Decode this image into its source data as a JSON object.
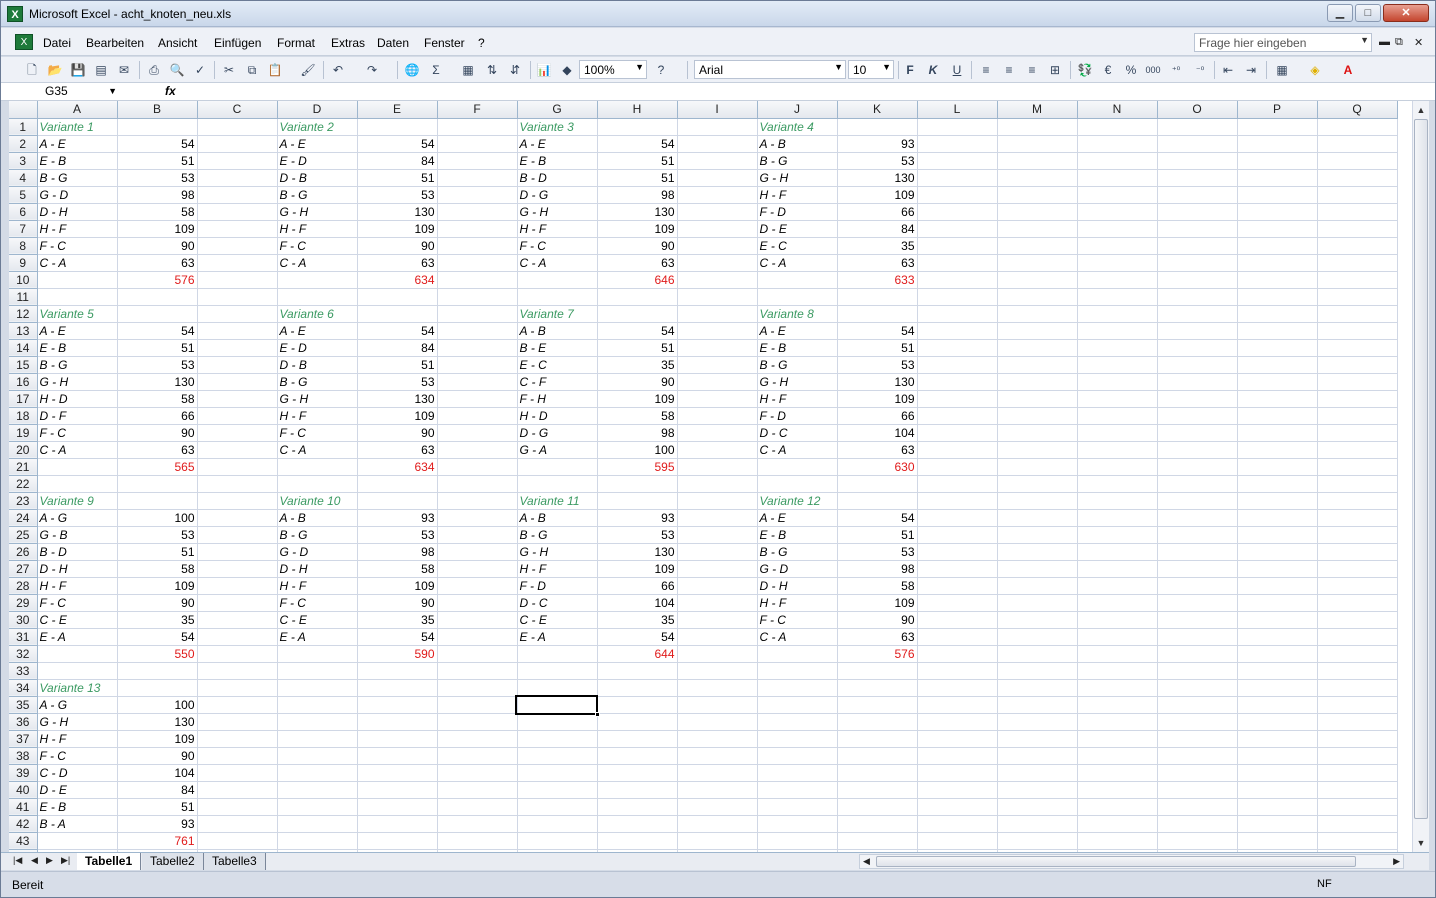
{
  "window": {
    "title": "Microsoft Excel - acht_knoten_neu.xls",
    "app_icon": "X",
    "minimize": "▁",
    "maximize": "□",
    "close": "✕"
  },
  "menu": {
    "items": [
      "Datei",
      "Bearbeiten",
      "Ansicht",
      "Einfügen",
      "Format",
      "Extras",
      "Daten",
      "Fenster",
      "?"
    ],
    "help_placeholder": "Frage hier eingeben",
    "doc_minimize": "▬",
    "doc_restore": "⧉",
    "doc_close": "✕"
  },
  "toolbar": {
    "zoom": "100%",
    "font_name": "Arial",
    "font_size": "10",
    "bold": "F",
    "italic": "K",
    "underline": "U",
    "currency": "€",
    "percent": "%",
    "thousands": "000"
  },
  "formula_bar": {
    "name_box": "G35",
    "fx": "fx",
    "content": ""
  },
  "sheet": {
    "columns": [
      "A",
      "B",
      "C",
      "D",
      "E",
      "F",
      "G",
      "H",
      "I",
      "J",
      "K",
      "L",
      "M",
      "N",
      "O",
      "P",
      "Q"
    ],
    "selected_column": "G",
    "selected_row": 35,
    "selected_cell": "G35",
    "blocks": [
      {
        "title": "Variante 1",
        "rows": [
          [
            "A - E",
            "54"
          ],
          [
            "E - B",
            "51"
          ],
          [
            "B - G",
            "53"
          ],
          [
            "G - D",
            "98"
          ],
          [
            "D - H",
            "58"
          ],
          [
            "H - F",
            "109"
          ],
          [
            "F - C",
            "90"
          ],
          [
            "C - A",
            "63"
          ]
        ],
        "sum": "576"
      },
      {
        "title": "Variante 2",
        "rows": [
          [
            "A - E",
            "54"
          ],
          [
            "E - D",
            "84"
          ],
          [
            "D - B",
            "51"
          ],
          [
            "B - G",
            "53"
          ],
          [
            "G - H",
            "130"
          ],
          [
            "H - F",
            "109"
          ],
          [
            "F - C",
            "90"
          ],
          [
            "C - A",
            "63"
          ]
        ],
        "sum": "634"
      },
      {
        "title": "Variante 3",
        "rows": [
          [
            "A - E",
            "54"
          ],
          [
            "E - B",
            "51"
          ],
          [
            "B - D",
            "51"
          ],
          [
            "D - G",
            "98"
          ],
          [
            "G - H",
            "130"
          ],
          [
            "H - F",
            "109"
          ],
          [
            "F - C",
            "90"
          ],
          [
            "C - A",
            "63"
          ]
        ],
        "sum": "646"
      },
      {
        "title": "Variante 4",
        "rows": [
          [
            "A - B",
            "93"
          ],
          [
            "B - G",
            "53"
          ],
          [
            "G - H",
            "130"
          ],
          [
            "H - F",
            "109"
          ],
          [
            "F - D",
            "66"
          ],
          [
            "D - E",
            "84"
          ],
          [
            "E - C",
            "35"
          ],
          [
            "C - A",
            "63"
          ]
        ],
        "sum": "633"
      },
      {
        "title": "Variante 5",
        "rows": [
          [
            "A - E",
            "54"
          ],
          [
            "E - B",
            "51"
          ],
          [
            "B - G",
            "53"
          ],
          [
            "G - H",
            "130"
          ],
          [
            "H - D",
            "58"
          ],
          [
            "D - F",
            "66"
          ],
          [
            "F - C",
            "90"
          ],
          [
            "C - A",
            "63"
          ]
        ],
        "sum": "565"
      },
      {
        "title": "Variante 6",
        "rows": [
          [
            "A - E",
            "54"
          ],
          [
            "E - D",
            "84"
          ],
          [
            "D - B",
            "51"
          ],
          [
            "B - G",
            "53"
          ],
          [
            "G - H",
            "130"
          ],
          [
            "H - F",
            "109"
          ],
          [
            "F - C",
            "90"
          ],
          [
            "C - A",
            "63"
          ]
        ],
        "sum": "634"
      },
      {
        "title": "Variante 7",
        "rows": [
          [
            "A - B",
            "54"
          ],
          [
            "B - E",
            "51"
          ],
          [
            "E - C",
            "35"
          ],
          [
            "C - F",
            "90"
          ],
          [
            "F - H",
            "109"
          ],
          [
            "H - D",
            "58"
          ],
          [
            "D - G",
            "98"
          ],
          [
            "G - A",
            "100"
          ]
        ],
        "sum": "595"
      },
      {
        "title": "Variante 8",
        "rows": [
          [
            "A - E",
            "54"
          ],
          [
            "E - B",
            "51"
          ],
          [
            "B - G",
            "53"
          ],
          [
            "G - H",
            "130"
          ],
          [
            "H - F",
            "109"
          ],
          [
            "F - D",
            "66"
          ],
          [
            "D - C",
            "104"
          ],
          [
            "C - A",
            "63"
          ]
        ],
        "sum": "630"
      },
      {
        "title": "Variante 9",
        "rows": [
          [
            "A - G",
            "100"
          ],
          [
            "G - B",
            "53"
          ],
          [
            "B - D",
            "51"
          ],
          [
            "D - H",
            "58"
          ],
          [
            "H - F",
            "109"
          ],
          [
            "F - C",
            "90"
          ],
          [
            "C - E",
            "35"
          ],
          [
            "E - A",
            "54"
          ]
        ],
        "sum": "550"
      },
      {
        "title": "Variante 10",
        "rows": [
          [
            "A - B",
            "93"
          ],
          [
            "B - G",
            "53"
          ],
          [
            "G - D",
            "98"
          ],
          [
            "D - H",
            "58"
          ],
          [
            "H - F",
            "109"
          ],
          [
            "F - C",
            "90"
          ],
          [
            "C - E",
            "35"
          ],
          [
            "E - A",
            "54"
          ]
        ],
        "sum": "590"
      },
      {
        "title": "Variante 11",
        "rows": [
          [
            "A - B",
            "93"
          ],
          [
            "B - G",
            "53"
          ],
          [
            "G - H",
            "130"
          ],
          [
            "H - F",
            "109"
          ],
          [
            "F - D",
            "66"
          ],
          [
            "D - C",
            "104"
          ],
          [
            "C - E",
            "35"
          ],
          [
            "E - A",
            "54"
          ]
        ],
        "sum": "644"
      },
      {
        "title": "Variante 12",
        "rows": [
          [
            "A - E",
            "54"
          ],
          [
            "E - B",
            "51"
          ],
          [
            "B - G",
            "53"
          ],
          [
            "G - D",
            "98"
          ],
          [
            "D - H",
            "58"
          ],
          [
            "H - F",
            "109"
          ],
          [
            "F - C",
            "90"
          ],
          [
            "C - A",
            "63"
          ]
        ],
        "sum": "576"
      },
      {
        "title": "Variante 13",
        "rows": [
          [
            "A - G",
            "100"
          ],
          [
            "G - H",
            "130"
          ],
          [
            "H - F",
            "109"
          ],
          [
            "F - C",
            "90"
          ],
          [
            "C - D",
            "104"
          ],
          [
            "D - E",
            "84"
          ],
          [
            "E - B",
            "51"
          ],
          [
            "B - A",
            "93"
          ]
        ],
        "sum": "761"
      }
    ]
  },
  "tabs": [
    "Tabelle1",
    "Tabelle2",
    "Tabelle3"
  ],
  "active_tab": "Tabelle1",
  "status": {
    "text": "Bereit",
    "indicator": "NF"
  },
  "colors": {
    "title_green": "#3b9a62",
    "sum_red": "#e01b1b",
    "selected_header": "#f1c05c"
  }
}
